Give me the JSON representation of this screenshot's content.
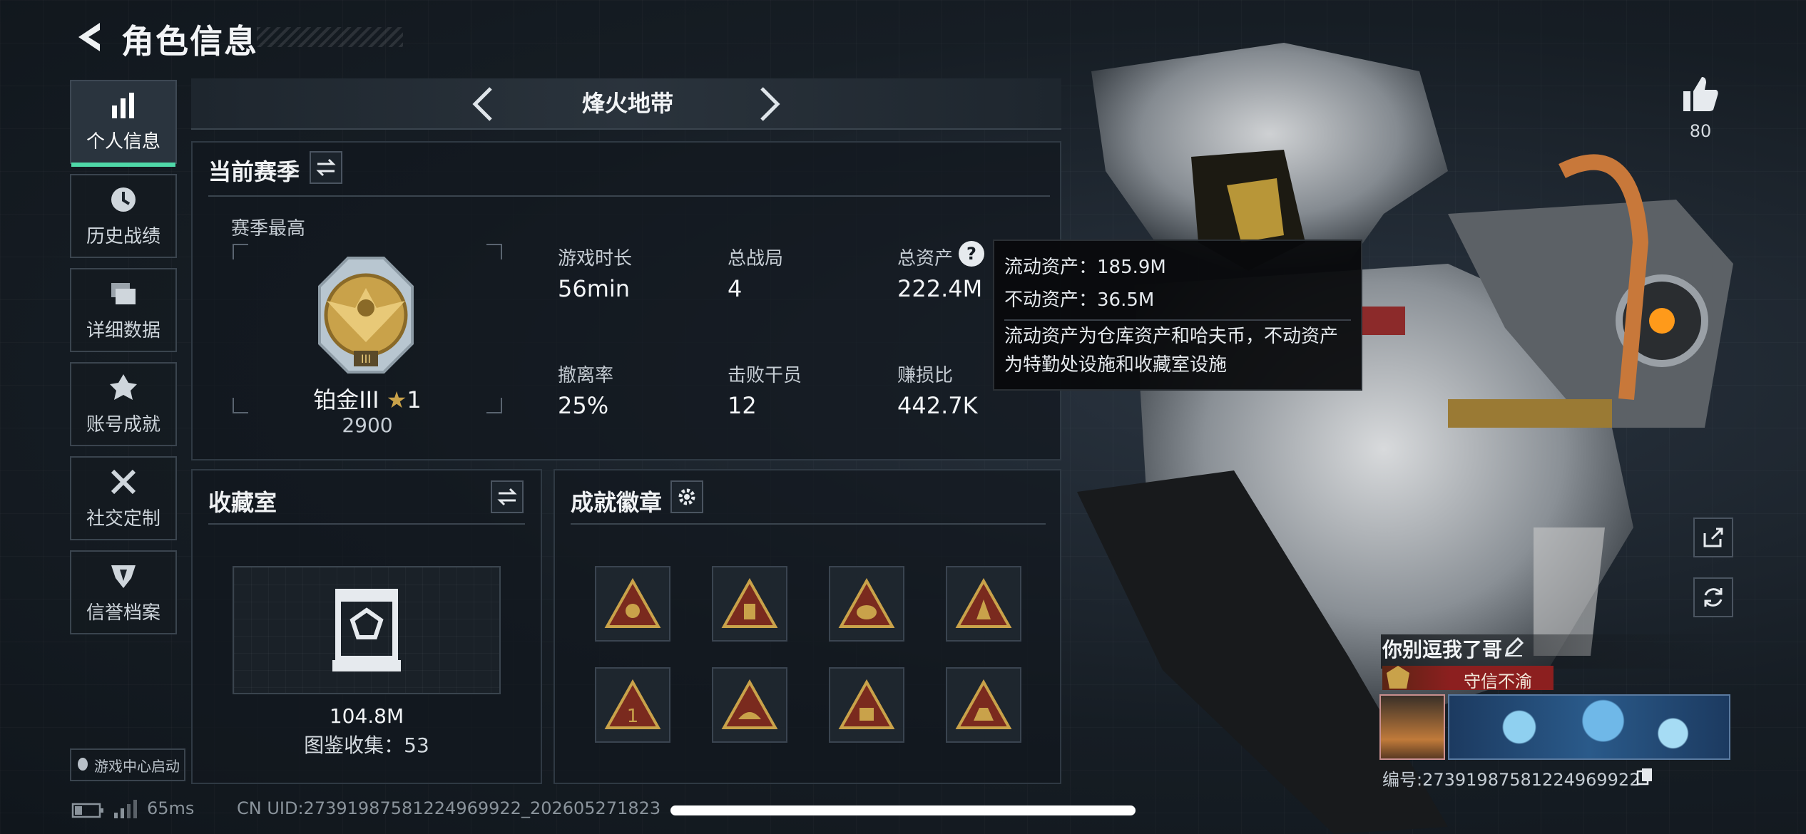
{
  "header": {
    "title": "角色信息"
  },
  "sidebar": {
    "items": [
      {
        "label": "个人信息",
        "icon": "bar-chart-icon",
        "active": true
      },
      {
        "label": "历史战绩",
        "icon": "clock-icon"
      },
      {
        "label": "详细数据",
        "icon": "folder-icon"
      },
      {
        "label": "账号成就",
        "icon": "medal-icon"
      },
      {
        "label": "社交定制",
        "icon": "tools-icon"
      },
      {
        "label": "信誉档案",
        "icon": "shield-icon"
      }
    ],
    "launcher": "游戏中心启动"
  },
  "mode_switcher": {
    "label": "烽火地带"
  },
  "season": {
    "title": "当前赛季",
    "best_label": "赛季最高",
    "rank_name": "铂金III",
    "stars": "1",
    "score": "2900",
    "stats": [
      {
        "label": "游戏时长",
        "value": "56min"
      },
      {
        "label": "总战局",
        "value": "4"
      },
      {
        "label": "总资产",
        "value": "222.4M"
      },
      {
        "label": "撤离率",
        "value": "25%"
      },
      {
        "label": "击败干员",
        "value": "12"
      },
      {
        "label": "赚损比",
        "value": "442.7K"
      }
    ]
  },
  "tooltip": {
    "line1": "流动资产：185.9M",
    "line2": "不动资产：36.5M",
    "desc1": "流动资产为仓库资产和哈夫币，不动资产",
    "desc2": "为特勤处设施和收藏室设施"
  },
  "collection": {
    "title": "收藏室",
    "value": "104.8M",
    "catalog": "图鉴收集：53"
  },
  "badges": {
    "title": "成就徽章",
    "count_visible": 8
  },
  "right": {
    "like_count": "80",
    "player_name": "你别逗我了哥",
    "title_tag": "守信不渝",
    "id_text": "编号:2739198758122496992​2"
  },
  "status_bar": {
    "ping": "65ms",
    "uid": "CN UID:27391987581224969922_202605271823"
  },
  "colors": {
    "accent": "#4fd8a8",
    "gold": "#c9a24a",
    "tag_red": "#8c1f1f"
  }
}
